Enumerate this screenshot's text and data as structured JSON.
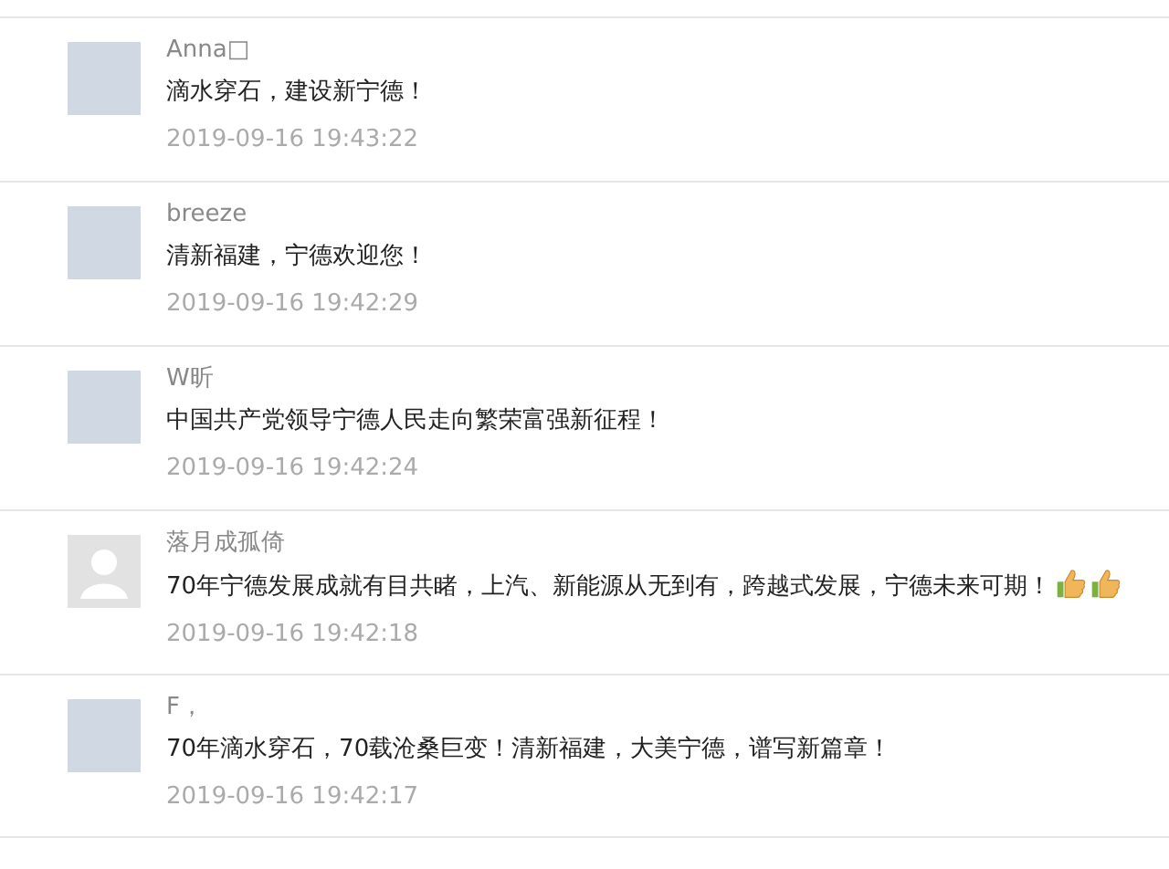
{
  "comments": [
    {
      "avatar": {
        "kind": "picture"
      },
      "user": "Anna□",
      "text": "滴水穿石，建设新宁德！",
      "time": "2019-09-16 19:43:22"
    },
    {
      "avatar": {
        "kind": "picture"
      },
      "user": "breeze",
      "text": "清新福建，宁德欢迎您！",
      "time": "2019-09-16 19:42:29"
    },
    {
      "avatar": {
        "kind": "picture"
      },
      "user": "W昕",
      "text": "中国共产党领导宁德人民走向繁荣富强新征程！",
      "time": "2019-09-16 19:42:24"
    },
    {
      "avatar": {
        "kind": "default"
      },
      "user": "落月成孤倚",
      "text": "70年宁德发展成就有目共睹，上汽、新能源从无到有，跨越式发展，宁德未来可期！",
      "reactions": [
        {
          "kind": "thumbs-up"
        },
        {
          "kind": "thumbs-up"
        }
      ],
      "time": "2019-09-16 19:42:18"
    },
    {
      "avatar": {
        "kind": "picture"
      },
      "user": "F，",
      "text": "70年滴水穿石，70载沧桑巨变！清新福建，大美宁德，谱写新篇章！",
      "time": "2019-09-16 19:42:17"
    }
  ]
}
